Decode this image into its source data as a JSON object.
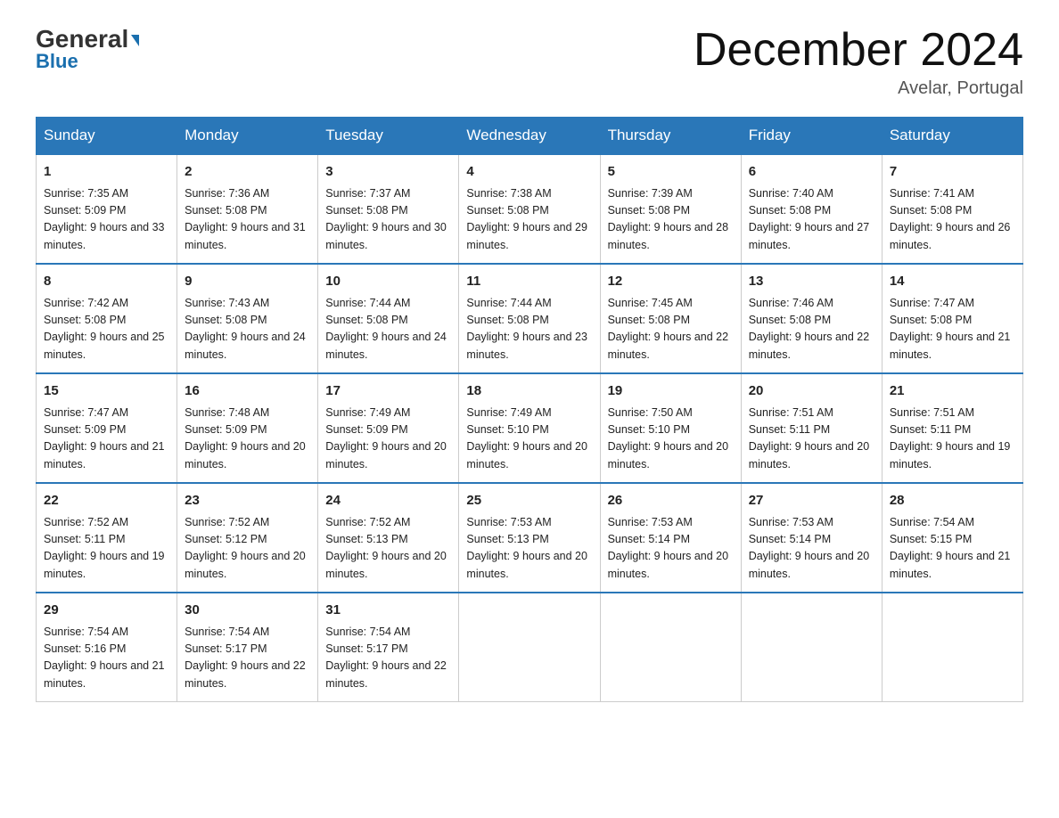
{
  "header": {
    "logo_top": "General",
    "logo_bottom": "Blue",
    "month_title": "December 2024",
    "location": "Avelar, Portugal"
  },
  "days_of_week": [
    "Sunday",
    "Monday",
    "Tuesday",
    "Wednesday",
    "Thursday",
    "Friday",
    "Saturday"
  ],
  "weeks": [
    [
      {
        "num": "1",
        "sunrise": "7:35 AM",
        "sunset": "5:09 PM",
        "daylight": "9 hours and 33 minutes."
      },
      {
        "num": "2",
        "sunrise": "7:36 AM",
        "sunset": "5:08 PM",
        "daylight": "9 hours and 31 minutes."
      },
      {
        "num": "3",
        "sunrise": "7:37 AM",
        "sunset": "5:08 PM",
        "daylight": "9 hours and 30 minutes."
      },
      {
        "num": "4",
        "sunrise": "7:38 AM",
        "sunset": "5:08 PM",
        "daylight": "9 hours and 29 minutes."
      },
      {
        "num": "5",
        "sunrise": "7:39 AM",
        "sunset": "5:08 PM",
        "daylight": "9 hours and 28 minutes."
      },
      {
        "num": "6",
        "sunrise": "7:40 AM",
        "sunset": "5:08 PM",
        "daylight": "9 hours and 27 minutes."
      },
      {
        "num": "7",
        "sunrise": "7:41 AM",
        "sunset": "5:08 PM",
        "daylight": "9 hours and 26 minutes."
      }
    ],
    [
      {
        "num": "8",
        "sunrise": "7:42 AM",
        "sunset": "5:08 PM",
        "daylight": "9 hours and 25 minutes."
      },
      {
        "num": "9",
        "sunrise": "7:43 AM",
        "sunset": "5:08 PM",
        "daylight": "9 hours and 24 minutes."
      },
      {
        "num": "10",
        "sunrise": "7:44 AM",
        "sunset": "5:08 PM",
        "daylight": "9 hours and 24 minutes."
      },
      {
        "num": "11",
        "sunrise": "7:44 AM",
        "sunset": "5:08 PM",
        "daylight": "9 hours and 23 minutes."
      },
      {
        "num": "12",
        "sunrise": "7:45 AM",
        "sunset": "5:08 PM",
        "daylight": "9 hours and 22 minutes."
      },
      {
        "num": "13",
        "sunrise": "7:46 AM",
        "sunset": "5:08 PM",
        "daylight": "9 hours and 22 minutes."
      },
      {
        "num": "14",
        "sunrise": "7:47 AM",
        "sunset": "5:08 PM",
        "daylight": "9 hours and 21 minutes."
      }
    ],
    [
      {
        "num": "15",
        "sunrise": "7:47 AM",
        "sunset": "5:09 PM",
        "daylight": "9 hours and 21 minutes."
      },
      {
        "num": "16",
        "sunrise": "7:48 AM",
        "sunset": "5:09 PM",
        "daylight": "9 hours and 20 minutes."
      },
      {
        "num": "17",
        "sunrise": "7:49 AM",
        "sunset": "5:09 PM",
        "daylight": "9 hours and 20 minutes."
      },
      {
        "num": "18",
        "sunrise": "7:49 AM",
        "sunset": "5:10 PM",
        "daylight": "9 hours and 20 minutes."
      },
      {
        "num": "19",
        "sunrise": "7:50 AM",
        "sunset": "5:10 PM",
        "daylight": "9 hours and 20 minutes."
      },
      {
        "num": "20",
        "sunrise": "7:51 AM",
        "sunset": "5:11 PM",
        "daylight": "9 hours and 20 minutes."
      },
      {
        "num": "21",
        "sunrise": "7:51 AM",
        "sunset": "5:11 PM",
        "daylight": "9 hours and 19 minutes."
      }
    ],
    [
      {
        "num": "22",
        "sunrise": "7:52 AM",
        "sunset": "5:11 PM",
        "daylight": "9 hours and 19 minutes."
      },
      {
        "num": "23",
        "sunrise": "7:52 AM",
        "sunset": "5:12 PM",
        "daylight": "9 hours and 20 minutes."
      },
      {
        "num": "24",
        "sunrise": "7:52 AM",
        "sunset": "5:13 PM",
        "daylight": "9 hours and 20 minutes."
      },
      {
        "num": "25",
        "sunrise": "7:53 AM",
        "sunset": "5:13 PM",
        "daylight": "9 hours and 20 minutes."
      },
      {
        "num": "26",
        "sunrise": "7:53 AM",
        "sunset": "5:14 PM",
        "daylight": "9 hours and 20 minutes."
      },
      {
        "num": "27",
        "sunrise": "7:53 AM",
        "sunset": "5:14 PM",
        "daylight": "9 hours and 20 minutes."
      },
      {
        "num": "28",
        "sunrise": "7:54 AM",
        "sunset": "5:15 PM",
        "daylight": "9 hours and 21 minutes."
      }
    ],
    [
      {
        "num": "29",
        "sunrise": "7:54 AM",
        "sunset": "5:16 PM",
        "daylight": "9 hours and 21 minutes."
      },
      {
        "num": "30",
        "sunrise": "7:54 AM",
        "sunset": "5:17 PM",
        "daylight": "9 hours and 22 minutes."
      },
      {
        "num": "31",
        "sunrise": "7:54 AM",
        "sunset": "5:17 PM",
        "daylight": "9 hours and 22 minutes."
      },
      null,
      null,
      null,
      null
    ]
  ]
}
